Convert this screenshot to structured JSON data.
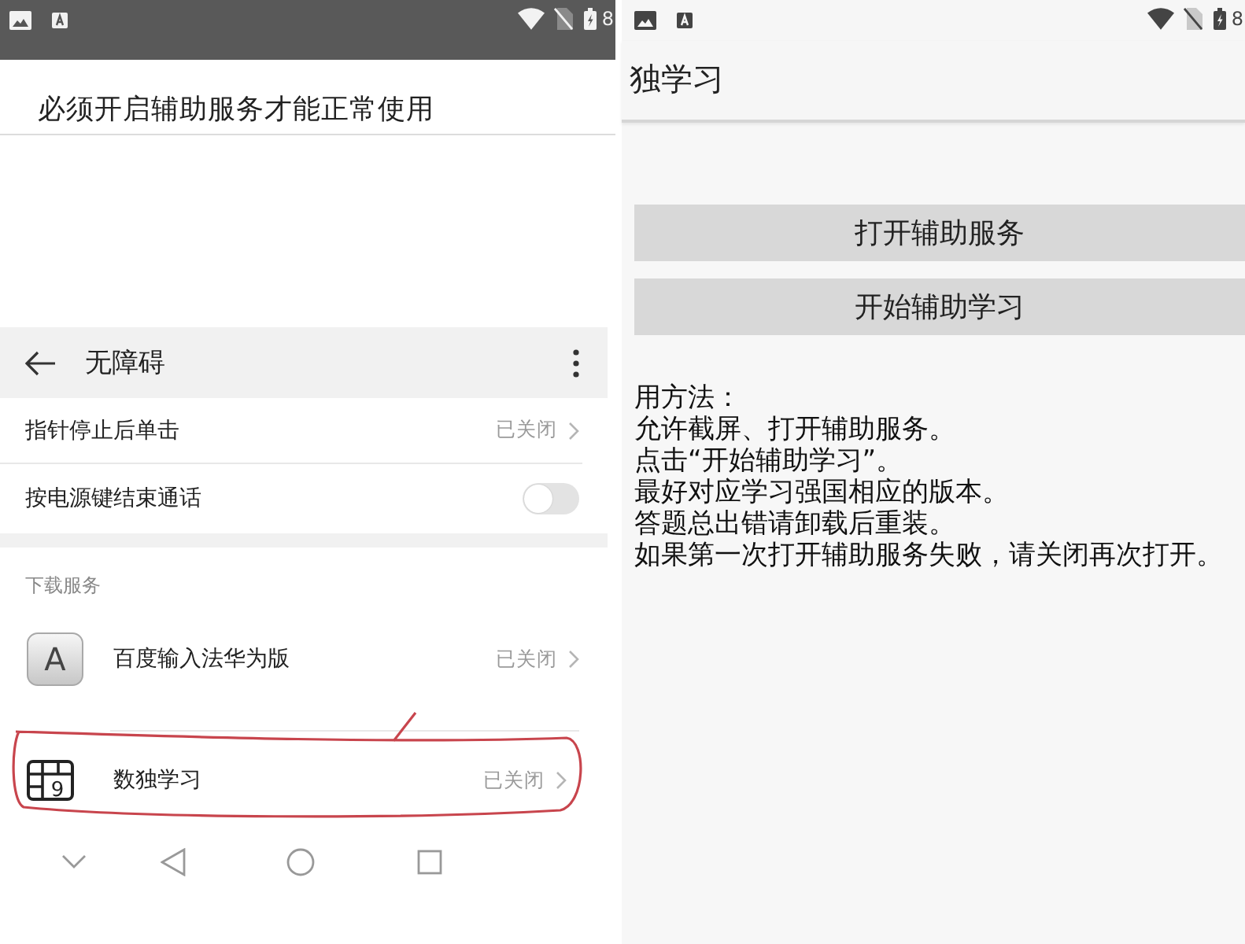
{
  "left_screen": {
    "status_bar": {
      "time": "8"
    },
    "prompt": "必须开启辅助服务才能正常使用",
    "settings": {
      "title": "无障碍",
      "items": [
        {
          "kind": "link",
          "label": "指针停止后单击",
          "status": "已关闭"
        },
        {
          "kind": "switch",
          "label": "按电源键结束通话",
          "on": false
        }
      ],
      "section_title": "下载服务",
      "services": [
        {
          "kind": "keyboard",
          "icon_text": "A",
          "label": "百度输入法华为版",
          "status": "已关闭",
          "circled": false
        },
        {
          "kind": "sudoku",
          "icon_text": "9",
          "label": "数独学习",
          "status": "已关闭",
          "circled": true
        }
      ]
    }
  },
  "right_screen": {
    "status_bar": {
      "time": "8"
    },
    "title": "独学习",
    "buttons": [
      "打开辅助服务",
      "开始辅助学习"
    ],
    "instructions": {
      "heading": "用方法：",
      "lines": [
        "允许截屏、打开辅助服务。",
        "点击“开始辅助学习”。",
        "最好对应学习强国相应的版本。",
        "答题总出错请卸载后重装。",
        "如果第一次打开辅助服务失败，请关闭再次打开。"
      ]
    }
  }
}
